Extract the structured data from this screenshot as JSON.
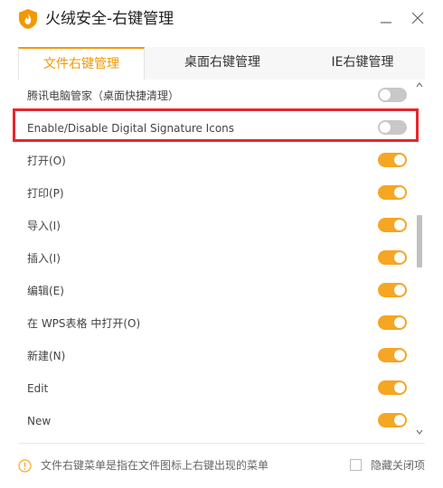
{
  "window": {
    "title": "火绒安全-右键管理",
    "logo_icon": "huorong-shield-flame-icon",
    "minimize_icon": "minimize-icon",
    "close_icon": "close-icon"
  },
  "tabs": [
    {
      "label": "文件右键管理",
      "active": true
    },
    {
      "label": "桌面右键管理",
      "active": false
    },
    {
      "label": "IE右键管理",
      "active": false
    }
  ],
  "items": [
    {
      "label": "腾讯电脑管家（桌面快捷清理）",
      "enabled": false
    },
    {
      "label": "Enable/Disable Digital Signature Icons",
      "enabled": false
    },
    {
      "label": "打开(O)",
      "enabled": true
    },
    {
      "label": "打印(P)",
      "enabled": true
    },
    {
      "label": "导入(I)",
      "enabled": true
    },
    {
      "label": "插入(I)",
      "enabled": true
    },
    {
      "label": "编辑(E)",
      "enabled": true
    },
    {
      "label": "在 WPS表格 中打开(O)",
      "enabled": true
    },
    {
      "label": "新建(N)",
      "enabled": true
    },
    {
      "label": "Edit",
      "enabled": true
    },
    {
      "label": "New",
      "enabled": true
    }
  ],
  "footer": {
    "info_icon": "info-icon",
    "hint": "文件右键菜单是指在文件图标上右键出现的菜单",
    "hide_closed_label": "隐藏关闭项",
    "hide_closed_checked": false
  },
  "colors": {
    "accent": "#f39800",
    "toggle_on": "#f5a623",
    "toggle_off": "#c8c8c8",
    "highlight_box": "#e8262d"
  }
}
